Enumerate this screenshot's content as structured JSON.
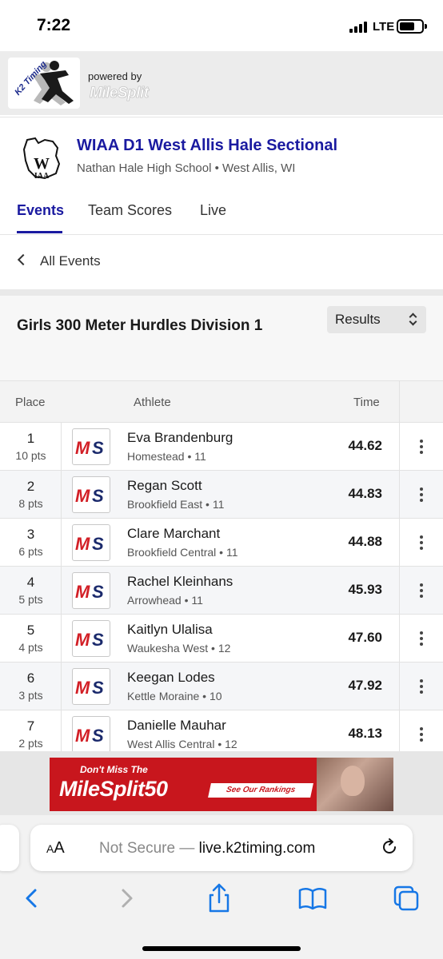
{
  "status_bar": {
    "time": "7:22",
    "network": "LTE"
  },
  "branding": {
    "powered_by": "powered by",
    "provider_wordmark": "MileSplit",
    "logo_text": "K2 Timing"
  },
  "meet": {
    "title": "WIAA D1 West Allis Hale Sectional",
    "subtitle": "Nathan Hale High School • West Allis, WI",
    "logo_icon": "wiaa-logo"
  },
  "tabs": [
    {
      "label": "Events",
      "active": true
    },
    {
      "label": "Team Scores",
      "active": false
    },
    {
      "label": "Live",
      "active": false
    }
  ],
  "nav": {
    "back_label": "All Events"
  },
  "event": {
    "title": "Girls 300 Meter Hurdles Division 1",
    "view_select": "Results"
  },
  "table": {
    "headers": {
      "place": "Place",
      "athlete": "Athlete",
      "time": "Time"
    },
    "rows": [
      {
        "place": "1",
        "points": "10 pts",
        "name": "Eva Brandenburg",
        "meta": "Homestead • 11",
        "time": "44.62"
      },
      {
        "place": "2",
        "points": "8 pts",
        "name": "Regan Scott",
        "meta": "Brookfield East • 11",
        "time": "44.83"
      },
      {
        "place": "3",
        "points": "6 pts",
        "name": "Clare Marchant",
        "meta": "Brookfield Central • 11",
        "time": "44.88"
      },
      {
        "place": "4",
        "points": "5 pts",
        "name": "Rachel Kleinhans",
        "meta": "Arrowhead • 11",
        "time": "45.93"
      },
      {
        "place": "5",
        "points": "4 pts",
        "name": "Kaitlyn Ulalisa",
        "meta": "Waukesha West • 12",
        "time": "47.60"
      },
      {
        "place": "6",
        "points": "3 pts",
        "name": "Keegan Lodes",
        "meta": "Kettle Moraine • 10",
        "time": "47.92"
      },
      {
        "place": "7",
        "points": "2 pts",
        "name": "Danielle Mauhar",
        "meta": "West Allis Central • 12",
        "time": "48.13"
      }
    ],
    "team_logo_text": {
      "m": "M",
      "s": "S"
    }
  },
  "ad": {
    "small_text": "Don't Miss The",
    "big_text": "MileSplit50",
    "cta": "See Our Rankings"
  },
  "browser": {
    "aa_label": "AA",
    "security": "Not Secure —",
    "domain": "live.k2timing.com"
  },
  "colors": {
    "accent": "#1a1aa0",
    "ad_red": "#c8161d",
    "ios_blue": "#1677e6"
  }
}
